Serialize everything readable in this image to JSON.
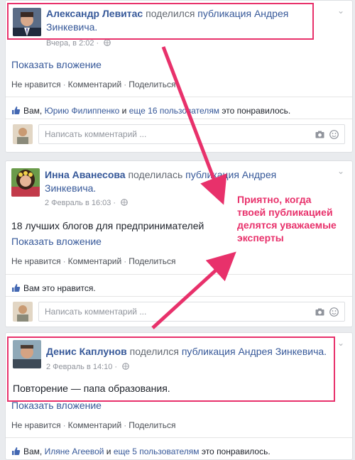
{
  "posts": [
    {
      "author": "Александр Левитас",
      "verb": "поделился",
      "shared": "публикация Андрея Зинкевича.",
      "time": "Вчера, в 2:02",
      "text": "",
      "show_attachment": "Показать вложение",
      "actions": [
        "Не нравится",
        "Комментарий",
        "Поделиться"
      ],
      "likes": {
        "prefix": "Вам, ",
        "person": "Юрию Филиппенко",
        "and": " и ",
        "others": "еще 16 пользователям",
        "suffix": " это понравилось."
      },
      "comment_placeholder": "Написать комментарий ..."
    },
    {
      "author": "Инна Аванесова",
      "verb": "поделилась",
      "shared": "публикация Андрея Зинкевича.",
      "time": "2 Февраль в 16:03",
      "text": "18 лучших блогов для предпринимателей",
      "show_attachment": "Показать вложение",
      "actions": [
        "Не нравится",
        "Комментарий",
        "Поделиться"
      ],
      "likes": {
        "prefix": "Вам это нравится.",
        "person": "",
        "and": "",
        "others": "",
        "suffix": ""
      },
      "comment_placeholder": "Написать комментарий ..."
    },
    {
      "author": "Денис Каплунов",
      "verb": "поделился",
      "shared": "публикация Андрея Зинкевича.",
      "time": "2 Февраль в 14:10",
      "text": "Повторение — папа образования.",
      "show_attachment": "Показать вложение",
      "actions": [
        "Не нравится",
        "Комментарий",
        "Поделиться"
      ],
      "likes": {
        "prefix": "Вам, ",
        "person": "Иляне Агеевой",
        "and": " и ",
        "others": "еще 5 пользователям",
        "suffix": " это понравилось."
      }
    }
  ],
  "callout": [
    "Приятно, когда",
    "твоей публикацией",
    "делятся уважаемые",
    "эксперты"
  ],
  "colors": {
    "accent": "#e8316b",
    "link": "#365899",
    "meta": "#90949c"
  }
}
